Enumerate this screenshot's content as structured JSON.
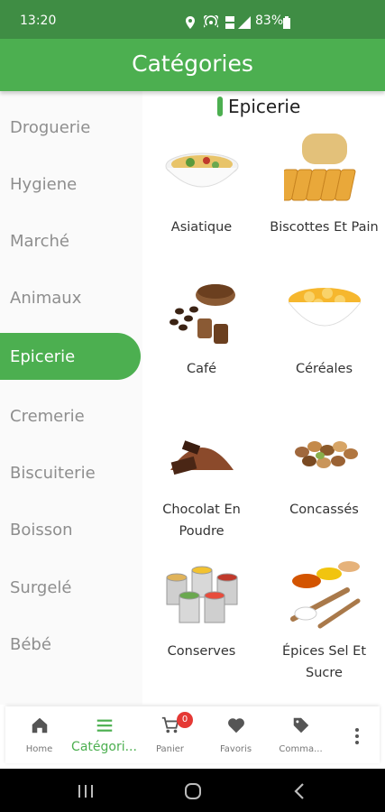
{
  "status_bar": {
    "time": "13:20",
    "battery": "83%",
    "icons": [
      "location-icon",
      "hotspot-icon",
      "volte-icon",
      "signal-icon",
      "battery-icon"
    ]
  },
  "app_bar": {
    "title": "Catégories"
  },
  "sidebar": {
    "items": [
      {
        "label": "Droguerie"
      },
      {
        "label": "Hygiene"
      },
      {
        "label": "Marché"
      },
      {
        "label": "Animaux"
      },
      {
        "label": "Epicerie",
        "active": true
      },
      {
        "label": "Cremerie"
      },
      {
        "label": "Biscuiterie"
      },
      {
        "label": "Boisson"
      },
      {
        "label": "Surgelé"
      },
      {
        "label": "Bébé"
      }
    ]
  },
  "section": {
    "title": "Epicerie"
  },
  "categories": [
    {
      "label": "Asiatique",
      "image": "noodle-bowl-image"
    },
    {
      "label": "Biscottes Et Pain",
      "image": "rusks-bread-image"
    },
    {
      "label": "Café",
      "image": "coffee-image"
    },
    {
      "label": "Céréales",
      "image": "cereal-bowl-image"
    },
    {
      "label": "Chocolat En Poudre",
      "image": "cocoa-powder-image"
    },
    {
      "label": "Concassés",
      "image": "nuts-image"
    },
    {
      "label": "Conserves",
      "image": "cans-image"
    },
    {
      "label": "Épices Sel Et Sucre",
      "image": "spices-image"
    }
  ],
  "bottom_nav": {
    "items": [
      {
        "label": "Home",
        "icon": "home-icon"
      },
      {
        "label": "Catégori...",
        "icon": "menu-icon",
        "active": true
      },
      {
        "label": "Panier",
        "icon": "cart-icon",
        "badge": "0"
      },
      {
        "label": "Favoris",
        "icon": "heart-icon"
      },
      {
        "label": "Comma...",
        "icon": "tag-icon"
      }
    ],
    "more_icon": "more-vert-icon"
  },
  "system_nav": [
    "recent-apps-icon",
    "home-circle-icon",
    "back-icon"
  ],
  "colors": {
    "primary": "#4caf50",
    "status_bar": "#3f8d44",
    "badge": "#e53935"
  }
}
